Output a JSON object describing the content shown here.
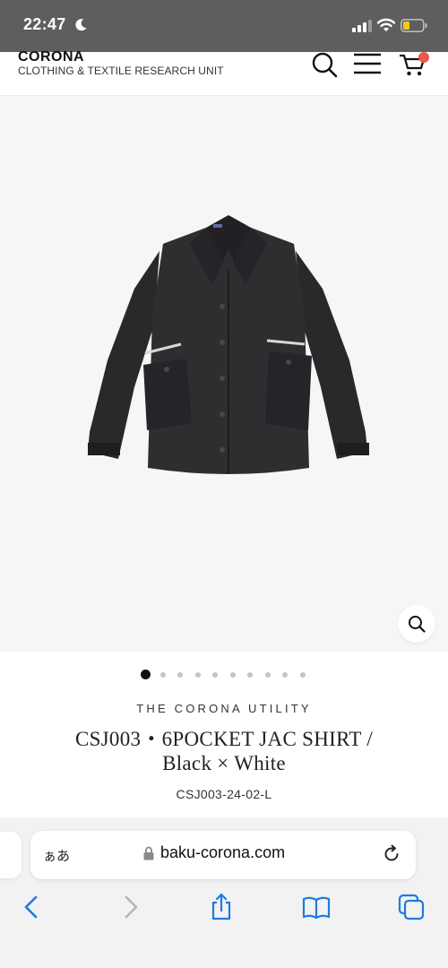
{
  "status_bar": {
    "time": "22:47"
  },
  "header": {
    "brand": "CORONA",
    "tagline": "CLOTHING & TEXTILE RESEARCH UNIT"
  },
  "carousel": {
    "total": 10,
    "active_index": 0
  },
  "product": {
    "brand": "THE CORONA UTILITY",
    "title_line1": "CSJ003・6POCKET JAC SHIRT /",
    "title_line2": "Black × White",
    "sku": "CSJ003-24-02-L"
  },
  "browser": {
    "aa_label": "ぁあ",
    "url": "baku-corona.com"
  },
  "colors": {
    "status_bar_bg": "#5e5e5e",
    "cart_badge": "#e8594e",
    "ios_blue": "#1f7ae0",
    "battery_fill": "#f5c816"
  },
  "icons": {
    "status": [
      "moon-icon",
      "signal-icon",
      "wifi-icon",
      "battery-icon"
    ],
    "header": [
      "search-icon",
      "menu-icon",
      "cart-icon"
    ],
    "toolbar": [
      "back-icon",
      "forward-icon",
      "share-icon",
      "bookmarks-icon",
      "tabs-icon"
    ]
  }
}
